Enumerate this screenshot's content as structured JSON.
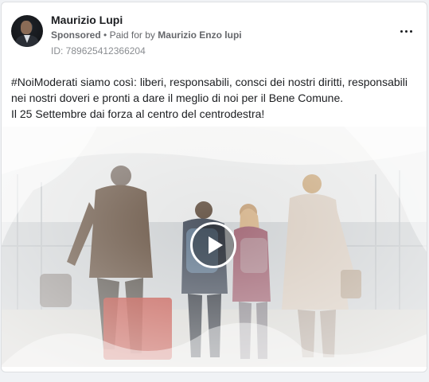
{
  "post": {
    "author": "Maurizio Lupi",
    "sponsored_label": "Sponsored",
    "separator": "•",
    "paid_for_prefix": "Paid for by",
    "paid_for_by": "Maurizio Enzo lupi",
    "id_line": "ID: 789625412366204",
    "more_icon": "more-horizontal-icon",
    "text_lines": [
      "#NoiModerati siamo così: liberi, responsabili, consci dei nostri diritti, responsabili",
      "nei nostri doveri e pronti a dare il meglio di noi per il Bene Comune.",
      "Il 25 Settembre dai forza al centro del centrodestra!"
    ],
    "video": {
      "play_icon": "play-icon",
      "colors": {
        "suitcase": "#c14a3f",
        "backpack": "#6a7f94",
        "dad_coat": "#6a5646",
        "mom_coat": "#d8ccc0"
      }
    }
  }
}
